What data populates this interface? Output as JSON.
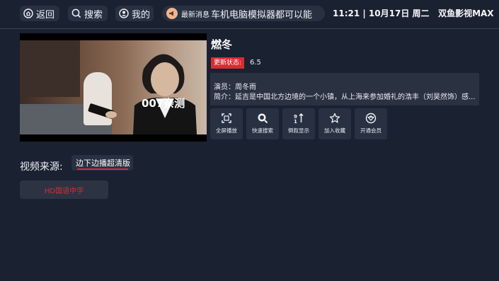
{
  "nav": {
    "back_label": "返回",
    "search_label": "搜索",
    "profile_label": "我的",
    "news_tag": "最新消息",
    "news_text": "车机电脑模拟器都可以能",
    "clock": "11:21 | 10月17日 周二",
    "app_name": "双鱼影视MAX"
  },
  "player": {
    "watermark": "007亲测"
  },
  "detail": {
    "title": "燃冬",
    "status_label": "更新状态:",
    "status_value": "6.5",
    "cast": "演员：周冬雨",
    "intro": "简介：延吉是中国北方边境的一个小镇，从上海来参加婚礼的浩丰（刘昊然饰）感..."
  },
  "actions": [
    {
      "label": "全屏播放",
      "icon": "fullscreen-icon"
    },
    {
      "label": "快速搜索",
      "icon": "search-icon"
    },
    {
      "label": "倒叙显示",
      "icon": "sort-icon"
    },
    {
      "label": "加入收藏",
      "icon": "star-icon"
    },
    {
      "label": "开通会员",
      "icon": "vip-icon"
    }
  ],
  "source": {
    "label": "视频来源:",
    "selected": "边下边播超清版",
    "accent": "#d92b32"
  },
  "episodes": [
    "HD国语中字"
  ]
}
